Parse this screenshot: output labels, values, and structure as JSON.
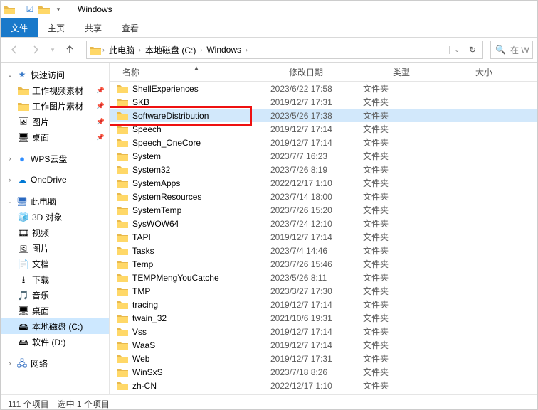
{
  "title": "Windows",
  "ribbon": {
    "file": "文件",
    "tabs": [
      "主页",
      "共享",
      "查看"
    ]
  },
  "breadcrumb": [
    "此电脑",
    "本地磁盘 (C:)",
    "Windows"
  ],
  "search_placeholder": "在 W",
  "columns": {
    "name": "名称",
    "date": "修改日期",
    "type": "类型",
    "size": "大小"
  },
  "type_folder": "文件夹",
  "sidebar": {
    "quick": {
      "label": "快速访问",
      "items": [
        {
          "label": "工作视频素材",
          "icon": "folder",
          "pin": true
        },
        {
          "label": "工作图片素材",
          "icon": "folder",
          "pin": true
        },
        {
          "label": "图片",
          "icon": "pictures",
          "pin": true
        },
        {
          "label": "桌面",
          "icon": "desktop",
          "pin": true
        }
      ]
    },
    "wps": {
      "label": "WPS云盘"
    },
    "onedrive": {
      "label": "OneDrive"
    },
    "thispc": {
      "label": "此电脑",
      "items": [
        {
          "label": "3D 对象",
          "icon": "3d"
        },
        {
          "label": "视频",
          "icon": "video"
        },
        {
          "label": "图片",
          "icon": "pictures"
        },
        {
          "label": "文档",
          "icon": "docs"
        },
        {
          "label": "下载",
          "icon": "down"
        },
        {
          "label": "音乐",
          "icon": "music"
        },
        {
          "label": "桌面",
          "icon": "desktop"
        },
        {
          "label": "本地磁盘 (C:)",
          "icon": "drive",
          "selected": true
        },
        {
          "label": "软件 (D:)",
          "icon": "drive"
        }
      ]
    },
    "network": {
      "label": "网络"
    }
  },
  "rows": [
    {
      "name": "ShellExperiences",
      "date": "2023/6/22 17:58"
    },
    {
      "name": "SKB",
      "date": "2019/12/7 17:31"
    },
    {
      "name": "SoftwareDistribution",
      "date": "2023/5/26 17:38",
      "selected": true,
      "highlight": true
    },
    {
      "name": "Speech",
      "date": "2019/12/7 17:14"
    },
    {
      "name": "Speech_OneCore",
      "date": "2019/12/7 17:14"
    },
    {
      "name": "System",
      "date": "2023/7/7 16:23"
    },
    {
      "name": "System32",
      "date": "2023/7/26 8:19"
    },
    {
      "name": "SystemApps",
      "date": "2022/12/17 1:10"
    },
    {
      "name": "SystemResources",
      "date": "2023/7/14 18:00"
    },
    {
      "name": "SystemTemp",
      "date": "2023/7/26 15:20"
    },
    {
      "name": "SysWOW64",
      "date": "2023/7/24 12:10"
    },
    {
      "name": "TAPI",
      "date": "2019/12/7 17:14"
    },
    {
      "name": "Tasks",
      "date": "2023/7/4 14:46"
    },
    {
      "name": "Temp",
      "date": "2023/7/26 15:46"
    },
    {
      "name": "TEMPMengYouCatche",
      "date": "2023/5/26 8:11"
    },
    {
      "name": "TMP",
      "date": "2023/3/27 17:30"
    },
    {
      "name": "tracing",
      "date": "2019/12/7 17:14"
    },
    {
      "name": "twain_32",
      "date": "2021/10/6 19:31"
    },
    {
      "name": "Vss",
      "date": "2019/12/7 17:14"
    },
    {
      "name": "WaaS",
      "date": "2019/12/7 17:14"
    },
    {
      "name": "Web",
      "date": "2019/12/7 17:31"
    },
    {
      "name": "WinSxS",
      "date": "2023/7/18 8:26"
    },
    {
      "name": "zh-CN",
      "date": "2022/12/17 1:10"
    }
  ],
  "status": {
    "count": "111 个项目",
    "sel": "选中 1 个项目"
  }
}
